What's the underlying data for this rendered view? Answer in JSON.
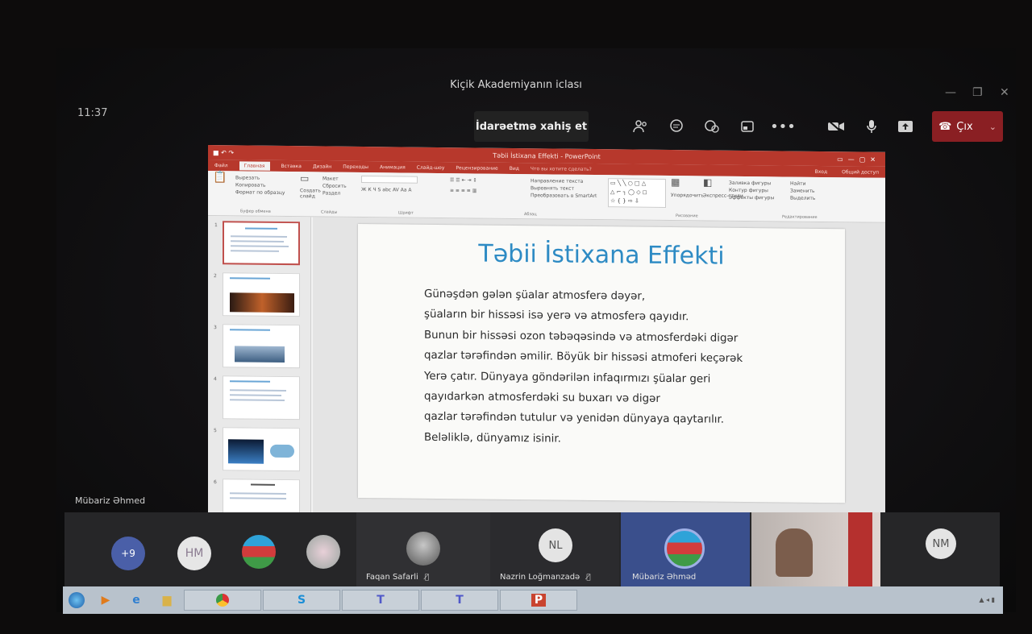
{
  "meeting": {
    "title": "Kiçik Akademiyanın iclası",
    "clock": "11:37"
  },
  "window_controls": {
    "minimize": "—",
    "restore": "❐",
    "close": "✕"
  },
  "toolbar": {
    "request_control_label": "İdarəetmə xahiş et",
    "leave_label": "Çıx",
    "icons": [
      "people-icon",
      "chat-icon",
      "reactions-icon",
      "share-tray-icon",
      "more-icon",
      "camera-off-icon",
      "microphone-icon",
      "share-screen-icon"
    ]
  },
  "ppt": {
    "window_title": "Təbii İstixana Effekti - PowerPoint",
    "tabs": [
      "Файл",
      "Главная",
      "Вставка",
      "Дизайн",
      "Переходы",
      "Анимация",
      "Слайд-шоу",
      "Рецензирование",
      "Вид"
    ],
    "search_hint": "Что вы хотите сделать?",
    "ribbon": {
      "cut": "Вырезать",
      "copy": "Копировать",
      "format_painter": "Формат по образцу",
      "clipboard_group": "Буфер обмена",
      "create_slide": "Создать слайд",
      "layout": "Макет",
      "reset": "Сбросить",
      "section": "Раздел",
      "slides_group": "Слайды",
      "font_group": "Шрифт",
      "paragraph_group": "Абзац",
      "text_direction": "Направление текста",
      "align_text": "Выровнять текст",
      "smartart": "Преобразовать в SmartArt",
      "arrange": "Упорядочить",
      "quick_styles": "Экспресс-стили",
      "fill": "Заливка фигуры",
      "outline": "Контур фигуры",
      "effects": "Эффекты фигуры",
      "drawing_group": "Рисование",
      "find": "Найти",
      "replace": "Заменить",
      "select": "Выделить",
      "editing_group": "Редактирование",
      "sign_in": "Вход",
      "share": "Общий доступ"
    },
    "slide": {
      "title": "Təbii İstixana Effekti",
      "lines": [
        "Günəşdən gələn şüalar atmosferə dəyər,",
        "şüaların bir hissəsi isə yerə və atmosferə qayıdır.",
        "Bunun bir hissəsi ozon təbəqəsində və atmosferdəki digər",
        "qazlar tərəfindən əmilir. Böyük bir hissəsi atmoferi keçərək",
        "Yerə çatır. Dünyaya göndərilən infaqırmızı şüalar geri",
        "qayıdarkən atmosferdəki su buxarı və digər",
        "qazlar tərəfindən tutulur və yenidən dünyaya qaytarılır.",
        "Beləliklə, dünyamız isinir."
      ]
    },
    "thumbnail_numbers": [
      "1",
      "2",
      "3",
      "4",
      "5",
      "6"
    ]
  },
  "presenter_name": "Mübariz Əhmed",
  "participants": {
    "overflow": "+9",
    "initials_1": "HM",
    "tiles": [
      {
        "initials": "",
        "name": "Faqan Safarli"
      },
      {
        "initials": "NL",
        "name": "Nazrin Loğmanzadə"
      },
      {
        "initials": "",
        "name": "Mübariz Əhməd"
      },
      {
        "initials": "",
        "name": ""
      },
      {
        "initials": "NM",
        "name": ""
      }
    ]
  },
  "taskbar": {
    "apps": [
      "start-icon",
      "media-player-icon",
      "ie-icon",
      "explorer-icon",
      "chrome-icon",
      "skype-icon",
      "teams-icon",
      "teams-icon",
      "powerpoint-icon"
    ]
  }
}
